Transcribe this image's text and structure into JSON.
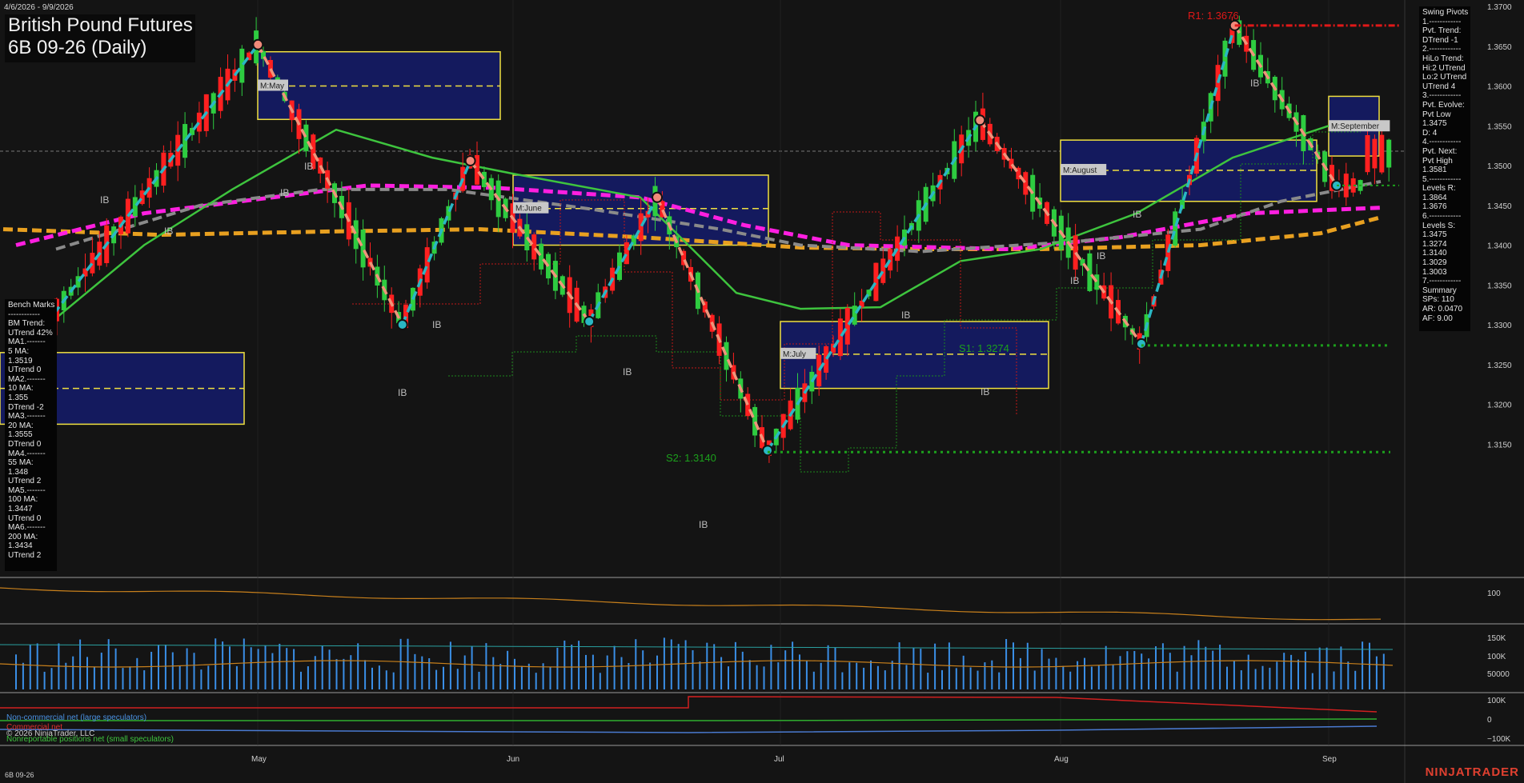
{
  "header": {
    "date_range": "4/6/2026 - 9/9/2026",
    "title_line1": "British Pound Futures",
    "title_line2": "6B 09-26 (Daily)"
  },
  "swing_pivots": {
    "lines": [
      "Swing Pivots",
      "1.------------",
      "Pvt. Trend:",
      "DTrend -1",
      "2.------------",
      "HiLo Trend:",
      "Hi:2 UTrend",
      "Lo:2 UTrend",
      "UTrend 4",
      "3.------------",
      "Pvt. Evolve:",
      "Pvt Low",
      "1.3475",
      "D: 4",
      "4.------------",
      "Pvt. Next:",
      "Pvt High",
      "1.3581",
      "5.------------",
      "Levels R:",
      "1.3864",
      "1.3676",
      "6.------------",
      "Levels S:",
      "1.3475",
      "1.3274",
      "1.3140",
      "1.3029",
      "1.3003",
      "7.------------",
      "Summary",
      "SPs: 110",
      "AR: 0.0470",
      "AF: 9.00"
    ]
  },
  "bench_marks": {
    "lines": [
      "Bench Marks",
      "------------",
      "BM Trend:",
      "UTrend 42%",
      "MA1.-------",
      "5 MA:",
      "1.3519",
      "UTrend 0",
      "MA2.-------",
      "10 MA:",
      "1.355",
      "DTrend -2",
      "MA3.-------",
      "20 MA:",
      "1.3555",
      "DTrend 0",
      "MA4.-------",
      "55 MA:",
      "1.348",
      "UTrend 2",
      "MA5.-------",
      "100 MA:",
      "1.3447",
      "UTrend 0",
      "MA6.-------",
      "200 MA:",
      "1.3434",
      "UTrend 2"
    ]
  },
  "annotations": {
    "r1": "R1: 1.3676",
    "s1": "S1: 1.3274",
    "s2": "S2: 1.3140",
    "ib": "IB",
    "month_boxes": [
      "M:May",
      "M:June",
      "M:July",
      "M:August",
      "M:September"
    ]
  },
  "cot_legend": {
    "noncommercial": "Non-commercial net (large speculators)",
    "commercial": "Commercial net",
    "copyright": "© 2026 NinjaTrader, LLC",
    "nonreportable": "Nonreportable positions net (small speculators)"
  },
  "footer": {
    "symbol": "6B 09-26",
    "brand": "NINJATRADER"
  },
  "colors": {
    "up_candle": "#2ecc40",
    "down_candle": "#ff2020",
    "ma_green": "#3ec43e",
    "ma_magenta": "#ff1fe0",
    "ma_orange": "#e8a020",
    "ma_gray": "#8a8a8a",
    "pivot_up": "#2ab7c4",
    "pivot_down": "#f0947a",
    "box_fill": "#141a5e",
    "box_border": "#f0e040"
  },
  "chart_data": {
    "type": "candlestick",
    "instrument": "6B 09-26 (Daily)",
    "price_axis": {
      "ticks": [
        1.315,
        1.32,
        1.325,
        1.33,
        1.335,
        1.34,
        1.345,
        1.35,
        1.355,
        1.36,
        1.365,
        1.37
      ],
      "ylim": [
        1.3105,
        1.37
      ]
    },
    "x_ticks": [
      "May",
      "Jun",
      "Jul",
      "Aug",
      "Sep"
    ],
    "swing_pivots_path": [
      {
        "date": "2026-04-06",
        "price": 1.33
      },
      {
        "date": "2026-05-01",
        "price": 1.3652
      },
      {
        "date": "2026-05-18",
        "price": 1.33
      },
      {
        "date": "2026-05-26",
        "price": 1.3506
      },
      {
        "date": "2026-06-09",
        "price": 1.3304
      },
      {
        "date": "2026-06-17",
        "price": 1.346
      },
      {
        "date": "2026-06-30",
        "price": 1.3142
      },
      {
        "date": "2026-07-25",
        "price": 1.3557
      },
      {
        "date": "2026-08-13",
        "price": 1.3276
      },
      {
        "date": "2026-08-24",
        "price": 1.3676
      },
      {
        "date": "2026-09-05",
        "price": 1.3475
      }
    ],
    "levels": {
      "R1": 1.3676,
      "S1": 1.3274,
      "S2": 1.314
    },
    "moving_averages": [
      {
        "name": "5 MA",
        "value": 1.3519
      },
      {
        "name": "10 MA",
        "value": 1.355
      },
      {
        "name": "20 MA",
        "value": 1.3555
      },
      {
        "name": "55 MA",
        "value": 1.348
      },
      {
        "name": "100 MA",
        "value": 1.3447
      },
      {
        "name": "200 MA",
        "value": 1.3434
      }
    ],
    "monthly_boxes": [
      {
        "label": "M:May",
        "high": 1.3643,
        "low": 1.3558,
        "mid": 1.36
      },
      {
        "label": "M:June",
        "high": 1.3488,
        "low": 1.34,
        "mid": 1.3446
      },
      {
        "label": "M:July",
        "high": 1.3304,
        "low": 1.322,
        "mid": 1.3263
      },
      {
        "label": "M:August",
        "high": 1.3532,
        "low": 1.3455,
        "mid": 1.3494
      },
      {
        "label": "M:September",
        "high": 1.3587,
        "low": 1.3512,
        "mid": 1.3549
      }
    ],
    "indicator_panel_1": {
      "ticks": [
        100
      ]
    },
    "volume_panel": {
      "ticks": [
        "150K",
        "100K",
        "50000"
      ]
    },
    "cot_panel": {
      "ticks": [
        "100K",
        "0",
        "−100K"
      ]
    }
  }
}
